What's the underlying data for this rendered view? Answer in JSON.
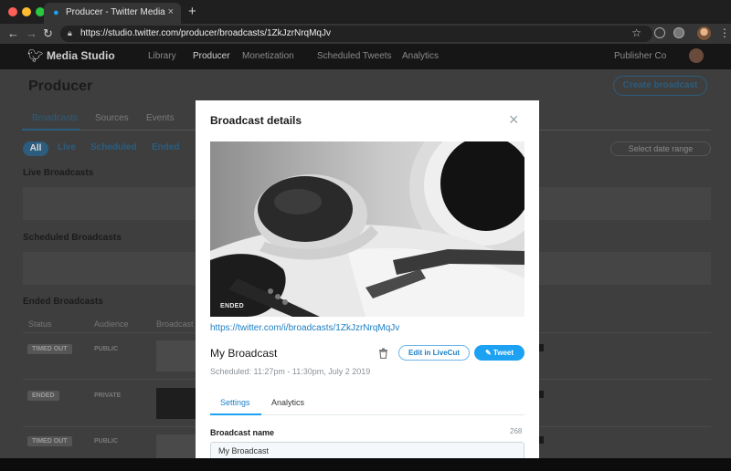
{
  "browser": {
    "tab_title": "Producer - Twitter Media Studio",
    "tab_close": "×",
    "new_tab": "+",
    "url": "https://studio.twitter.com/producer/broadcasts/1ZkJzrNrqMqJv"
  },
  "app": {
    "brand": "Media Studio",
    "nav": [
      "Library",
      "Producer",
      "Monetization",
      "Scheduled Tweets",
      "Analytics"
    ],
    "publisher": "Publisher Co",
    "page_title": "Producer",
    "create_button": "Create broadcast",
    "subtabs": [
      "Broadcasts",
      "Sources",
      "Events"
    ],
    "filters": [
      "All",
      "Live",
      "Scheduled",
      "Ended"
    ],
    "date_range": "Select date range",
    "sections": {
      "live": "Live Broadcasts",
      "scheduled": "Scheduled Broadcasts",
      "ended": "Ended Broadcasts"
    },
    "table_headers": [
      "Status",
      "Audience",
      "Broadcast"
    ],
    "rows": [
      {
        "status": "TIMED OUT",
        "audience": "PUBLIC"
      },
      {
        "status": "ENDED",
        "audience": "PRIVATE"
      },
      {
        "status": "TIMED OUT",
        "audience": "PUBLIC"
      }
    ]
  },
  "modal": {
    "title": "Broadcast details",
    "close": "×",
    "preview_badge": "ENDED",
    "link": "https://twitter.com/i/broadcasts/1ZkJzrNrqMqJv",
    "name": "My Broadcast",
    "edit_button": "Edit in LiveCut",
    "tweet_button": "Tweet",
    "scheduled": "Scheduled: 11:27pm - 11:30pm, July 2 2019",
    "tabs": [
      "Settings",
      "Analytics"
    ],
    "field_label": "Broadcast name",
    "char_count": "268",
    "field_value": "My Broadcast"
  },
  "colors": {
    "accent": "#1da1f2",
    "link": "#1b7fc4",
    "dim_accent": "#2c5d7e"
  }
}
